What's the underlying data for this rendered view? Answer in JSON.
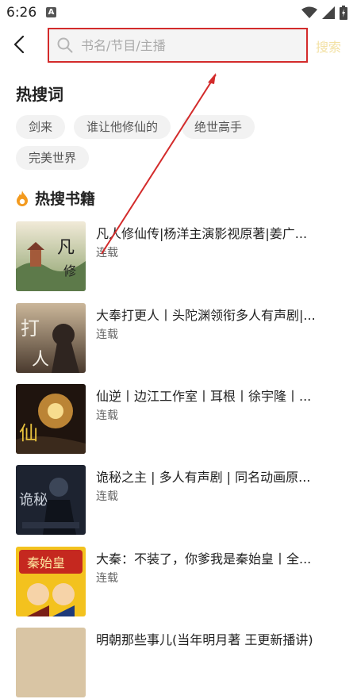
{
  "status_bar": {
    "time": "6:26",
    "notification_letter": "A"
  },
  "header": {
    "search": {
      "placeholder": "书名/节目/主播",
      "value": ""
    },
    "search_button_label": "搜索"
  },
  "hot_words": {
    "title": "热搜词",
    "tags": [
      "剑来",
      "谁让他修仙的",
      "绝世高手",
      "完美世界"
    ]
  },
  "hot_books": {
    "title": "热搜书籍",
    "items": [
      {
        "title": "凡人修仙传|杨洋主演影视原著|姜广...",
        "status": "连载"
      },
      {
        "title": "大奉打更人丨头陀渊领衔多人有声剧|...",
        "status": "连载"
      },
      {
        "title": "仙逆丨边江工作室丨耳根丨徐宇隆丨...",
        "status": "连载"
      },
      {
        "title": "诡秘之主 | 多人有声剧 | 同名动画原...",
        "status": "连载"
      },
      {
        "title": "大秦：不装了，你爹我是秦始皇丨全...",
        "status": "连载"
      },
      {
        "title": "明朝那些事儿(当年明月著 王更新播讲)",
        "status": ""
      }
    ]
  },
  "colors": {
    "annotation_red": "#d32b2b",
    "search_bg": "#f4f4f4",
    "tag_bg": "#f2f2f2",
    "fire_orange": "#f39a1e"
  }
}
